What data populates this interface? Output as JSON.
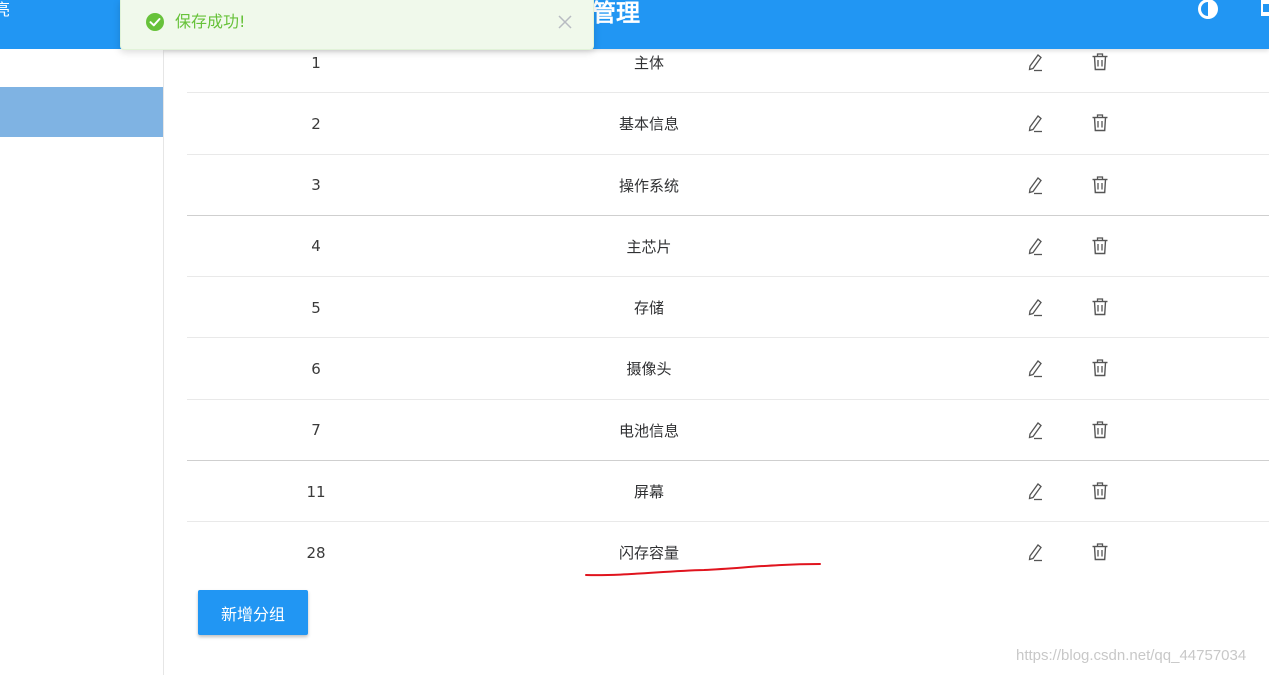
{
  "header": {
    "left_text": "亮",
    "title": "管理"
  },
  "toast": {
    "message": "保存成功!"
  },
  "table": {
    "rows": [
      {
        "id": "1",
        "name": "主体"
      },
      {
        "id": "2",
        "name": "基本信息"
      },
      {
        "id": "3",
        "name": "操作系统"
      },
      {
        "id": "4",
        "name": "主芯片"
      },
      {
        "id": "5",
        "name": "存储"
      },
      {
        "id": "6",
        "name": "摄像头"
      },
      {
        "id": "7",
        "name": "电池信息"
      },
      {
        "id": "11",
        "name": "屏幕"
      },
      {
        "id": "28",
        "name": "闪存容量"
      }
    ]
  },
  "actions": {
    "add_group_label": "新增分组"
  },
  "watermark": "https://blog.csdn.net/qq_44757034",
  "colors": {
    "primary": "#2196f3",
    "sidebar_active": "#7fb3e3",
    "success": "#67c23a",
    "success_bg": "#f0f9eb",
    "annotation": "#e0141e"
  },
  "icons": {
    "edit": "pencil-icon",
    "delete": "trash-icon",
    "theme": "contrast-icon",
    "toast": "check-circle-icon",
    "close": "close-icon"
  }
}
